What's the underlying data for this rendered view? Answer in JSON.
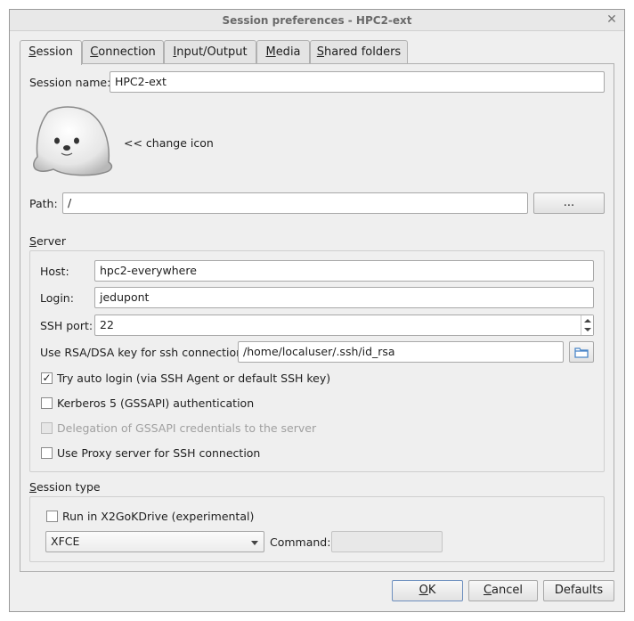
{
  "window": {
    "title": "Session preferences - HPC2-ext"
  },
  "tabs": [
    {
      "label": "Session",
      "accel": "S",
      "rest": "ession"
    },
    {
      "label": "Connection",
      "accel": "C",
      "rest": "onnection"
    },
    {
      "label": "Input/Output",
      "accel": "I",
      "rest": "nput/Output"
    },
    {
      "label": "Media",
      "accel": "M",
      "rest": "edia"
    },
    {
      "label": "Shared folders",
      "accel": "S",
      "rest": "hared folders"
    }
  ],
  "session": {
    "name_label": "Session name:",
    "name_value": "HPC2-ext",
    "change_icon_label": "<< change icon",
    "path_label": "Path:",
    "path_value": "/",
    "browse_label": "..."
  },
  "server": {
    "group_label_accel": "S",
    "group_label_rest": "erver",
    "host_label": "Host:",
    "host_value": "hpc2-everywhere",
    "login_label": "Login:",
    "login_value": "jedupont",
    "ssh_port_label": "SSH port:",
    "ssh_port_value": "22",
    "key_label": "Use RSA/DSA key for ssh connection:",
    "key_value": "/home/localuser/.ssh/id_rsa",
    "auto_login_label": "Try auto login (via SSH Agent or default SSH key)",
    "auto_login_checked": "✓",
    "kerberos_label": "Kerberos 5 (GSSAPI) authentication",
    "delegation_label": "Delegation of GSSAPI credentials to the server",
    "proxy_label": "Use Proxy server for SSH connection"
  },
  "session_type": {
    "group_label_accel": "S",
    "group_label_rest": "ession type",
    "kdrive_label": "Run in X2GoKDrive (experimental)",
    "type_value": "XFCE",
    "command_label": "Command:",
    "command_value": ""
  },
  "buttons": {
    "ok_accel": "O",
    "ok_rest": "K",
    "cancel_accel": "C",
    "cancel_rest": "ancel",
    "defaults": "Defaults"
  },
  "colors": {
    "accent": "#6d8fbf",
    "folder_icon": "#4a86c8"
  }
}
